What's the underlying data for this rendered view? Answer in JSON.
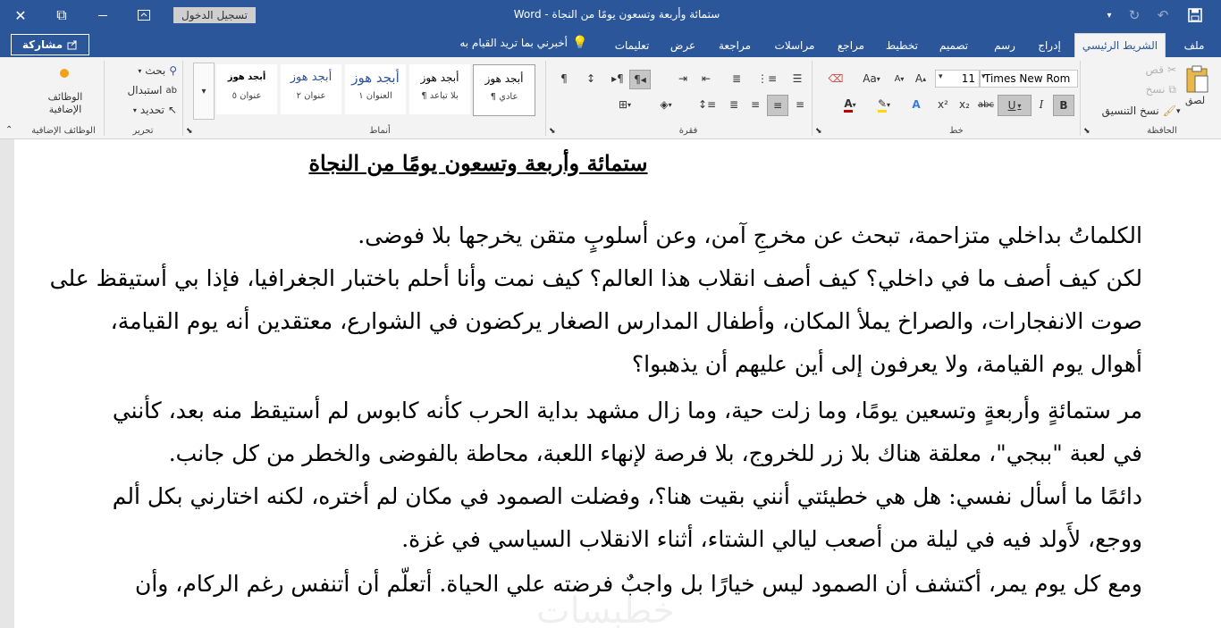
{
  "window": {
    "title": "ستمائة وأربعة وتسعون يومًا من النجاة  -  Word",
    "sign_in": "تسجيل الدخول",
    "close_glyph": "✕",
    "restore_glyph": "⧉",
    "ribbon_display_glyph": "⊡",
    "minimize_glyph": "—"
  },
  "ribbon_tabs": {
    "file": "ملف",
    "home": "الشريط الرئيسي",
    "insert": "إدراج",
    "draw": "رسم",
    "design": "تصميم",
    "layout": "تخطيط",
    "references": "مراجع",
    "mailings": "مراسلات",
    "review": "مراجعة",
    "view": "عرض",
    "help": "تعليمات",
    "tell_me": "أخبرني بما تريد القيام به",
    "share": "مشاركة"
  },
  "clipboard": {
    "paste": "لصق",
    "cut": "قص",
    "copy": "نسخ",
    "format_painter": "نسخ التنسيق",
    "group": "الحافظة"
  },
  "font": {
    "name": "Times New Rom",
    "size": "11",
    "group": "خط",
    "bold": "B",
    "italic": "I",
    "underline": "U",
    "strike": "abc",
    "subscript": "x₂",
    "superscript": "x²",
    "change_case": "Aa",
    "grow": "A",
    "shrink": "A",
    "color_accent": "#c00000",
    "highlight_accent": "#ffd700"
  },
  "paragraph": {
    "group": "فقرة"
  },
  "styles": {
    "group": "أنماط",
    "items": [
      {
        "preview": "أبجد هوز",
        "name": "¶ عادي"
      },
      {
        "preview": "أبجد هوز",
        "name": "¶ بلا تباعد"
      },
      {
        "preview": "أبجد هوز",
        "name": "العنوان ١"
      },
      {
        "preview": "أبجد هوز",
        "name": "عنوان ٢"
      },
      {
        "preview": "أبجد هوز",
        "name": "عنوان ٥"
      }
    ]
  },
  "editing": {
    "group": "تحرير",
    "find": "بحث",
    "replace": "استبدال",
    "select": "تحديد"
  },
  "addins": {
    "label": "الوظائف الإضافية",
    "group": "الوظائف الإضافية"
  },
  "document": {
    "title": "ستمائة وأربعة وتسعون يومًا من النجاة",
    "lines": [
      "الكلماتُ بداخلي متزاحمة، تبحث عن مخرجِ آمن، وعن أسلوبٍ متقن يخرجها بلا فوضى.",
      "لكن كيف أصف ما في داخلي؟ كيف أصف انقلاب هذا العالم؟ كيف نمت وأنا أحلم باختبار الجغرافيا، فإذا بي أستيقظ على",
      "صوت الانفجارات، والصراخ يملأ المكان، وأطفال المدارس الصغار يركضون في الشوارع، معتقدين أنه يوم القيامة،",
      "أهوال يوم القيامة، ولا يعرفون إلى أين عليهم أن يذهبوا؟",
      "مر ستمائةٍ وأربعةٍ وتسعين يومًا، وما زلت حية، وما زال مشهد بداية الحرب كأنه كابوس لم أستيقظ منه بعد، كأنني",
      "في لعبة \"ببجي\"، معلقة هناك بلا زر للخروج، بلا فرصة لإنهاء اللعبة، محاطة بالفوضى والخطر من كل جانب.",
      "دائمًا ما أسأل نفسي: هل هي خطيئتي أنني بقيت هنا؟، وفضلت الصمود في مكان لم أختره، لكنه اختارني بكل ألم",
      "ووجع، لأَولد فيه في ليلة من أصعب ليالي الشتاء، أثناء الانقلاب السياسي في غزة.",
      "ومع كل يوم يمر، أكتشف أن الصمود ليس خيارًا بل واجبٌ فرضته علي الحياة. أتعلّم أن أتنفس رغم الركام، وأن"
    ],
    "watermark": "خطبسات"
  }
}
